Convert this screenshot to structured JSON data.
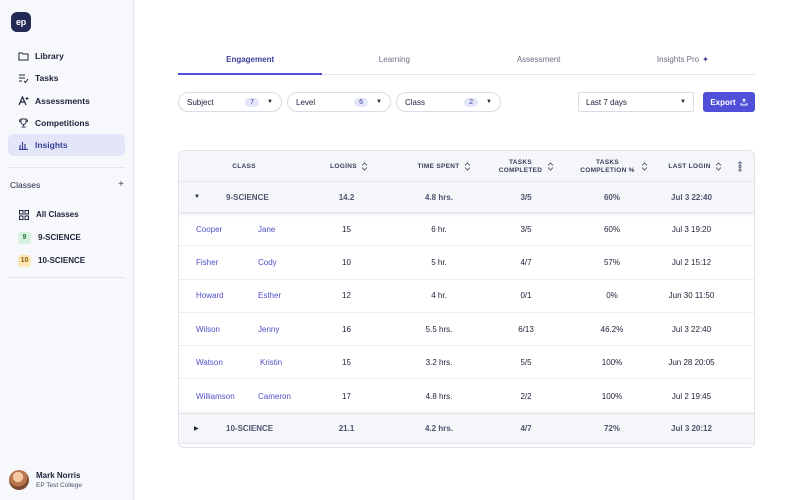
{
  "app": {
    "logo_text": "ep"
  },
  "sidebar": {
    "nav": [
      {
        "label": "Library",
        "icon": "folder-icon"
      },
      {
        "label": "Tasks",
        "icon": "tasks-icon"
      },
      {
        "label": "Assessments",
        "icon": "assessment-icon"
      },
      {
        "label": "Competitions",
        "icon": "trophy-icon"
      },
      {
        "label": "Insights",
        "icon": "bar-chart-icon",
        "active": true
      }
    ],
    "classes_heading": "Classes",
    "add_label": "+",
    "classes": [
      {
        "label": "All Classes",
        "icon": "grid-icon"
      },
      {
        "badge": "9",
        "label": "9-SCIENCE",
        "badge_color": "#d6f2de"
      },
      {
        "badge": "10",
        "label": "10-SCIENCE",
        "badge_color": "#fde7b8"
      }
    ],
    "user": {
      "name": "Mark Norris",
      "org": "EP Test College"
    }
  },
  "tabs": [
    {
      "label": "Engagement",
      "active": true
    },
    {
      "label": "Learning"
    },
    {
      "label": "Assessment"
    },
    {
      "label": "Insights Pro",
      "icon": "sparkle-icon"
    }
  ],
  "filters": [
    {
      "label": "Subject",
      "count": "7"
    },
    {
      "label": "Level",
      "count": "6"
    },
    {
      "label": "Class",
      "count": "2"
    }
  ],
  "date_range": {
    "value": "Last 7 days"
  },
  "export": {
    "label": "Export"
  },
  "table": {
    "columns": [
      {
        "label": "CLASS"
      },
      {
        "label": "LOGINS"
      },
      {
        "label": "TIME SPENT"
      },
      {
        "label": "TASKS COMPLETED"
      },
      {
        "label": "TASKS COMPLETION %"
      },
      {
        "label": "LAST LOGIN"
      }
    ],
    "groups": [
      {
        "name": "9-SCIENCE",
        "expanded": true,
        "logins": "14.2",
        "time": "4.8 hrs.",
        "tasks": "3/5",
        "pct": "60%",
        "last": "Jul 3 22:40",
        "rows": [
          {
            "last_name": "Cooper",
            "first_name": "Jane",
            "logins": "15",
            "time": "6 hr.",
            "tasks": "3/5",
            "pct": "60%",
            "last": "Jul 3 19:20"
          },
          {
            "last_name": "Fisher",
            "first_name": "Cody",
            "logins": "10",
            "time": "5 hr.",
            "tasks": "4/7",
            "pct": "57%",
            "last": "Jul 2 15:12"
          },
          {
            "last_name": "Howard",
            "first_name": "Esther",
            "logins": "12",
            "time": "4 hr.",
            "tasks": "0/1",
            "pct": "0%",
            "last": "Jun 30 11:50"
          },
          {
            "last_name": "Wilson",
            "first_name": "Jenny",
            "logins": "16",
            "time": "5.5 hrs.",
            "tasks": "6/13",
            "pct": "46.2%",
            "last": "Jul 3 22:40"
          },
          {
            "last_name": "Watson",
            "first_name": "Kristin",
            "logins": "15",
            "time": "3.2 hrs.",
            "tasks": "5/5",
            "pct": "100%",
            "last": "Jun 28 20:05"
          },
          {
            "last_name": "Williamson",
            "first_name": "Cameron",
            "logins": "17",
            "time": "4.8 hrs.",
            "tasks": "2/2",
            "pct": "100%",
            "last": "Jul 2 19:45"
          }
        ]
      },
      {
        "name": "10-SCIENCE",
        "expanded": false,
        "logins": "21.1",
        "time": "4.2 hrs.",
        "tasks": "4/7",
        "pct": "72%",
        "last": "Jul 3 20:12"
      }
    ]
  }
}
